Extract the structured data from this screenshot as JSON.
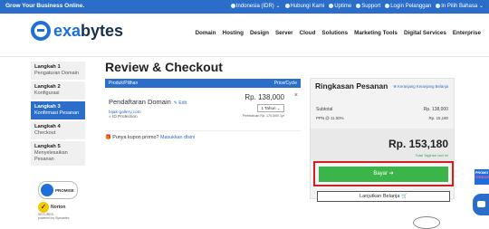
{
  "topbar": {
    "tagline": "Grow Your Business Online.",
    "links": [
      {
        "icon": "flag-icon",
        "label": "Indonesia (IDR) ⌄"
      },
      {
        "icon": "phone-icon",
        "label": "Hubungi Kami"
      },
      {
        "icon": "cloud-icon",
        "label": "Uptime"
      },
      {
        "icon": "support-icon",
        "label": "Support"
      },
      {
        "icon": "user-icon",
        "label": "Login Pelanggan"
      },
      {
        "icon": "translate-icon",
        "label": "In Pilih Bahasa ⌄"
      }
    ]
  },
  "brand": {
    "name_prefix": "exa",
    "name_suffix": "bytes"
  },
  "menu": [
    "Domain",
    "Hosting",
    "Design",
    "Server",
    "Cloud",
    "Solutions",
    "Marketing Tools",
    "Digital Services",
    "Enterprise"
  ],
  "steps": [
    {
      "step": "Langkah 1",
      "label": "Pengaturan Domain",
      "active": false
    },
    {
      "step": "Langkah 2",
      "label": "Konfigurasi",
      "active": false
    },
    {
      "step": "Langkah 3",
      "label": "Konfirmasi Pesanan",
      "active": true
    },
    {
      "step": "Langkah 4",
      "label": "Checkout",
      "active": false
    },
    {
      "step": "Langkah 5",
      "label": "Menyelesaikan Pesanan",
      "active": false
    }
  ],
  "badges": {
    "promise": "PROMISE",
    "norton": "Norton",
    "norton_sub": "SECURED",
    "norton_by": "powered by Symantec"
  },
  "page": {
    "title": "Review & Checkout"
  },
  "products": {
    "header_left": "Produk/Pilihan",
    "header_right": "Price/Cycle",
    "item": {
      "name": "Pendaftaran Domain",
      "edit": "✎ Edit",
      "domain": "bijak-gallery.com",
      "addon": "» ID Protection",
      "price": "Rp. 138,000",
      "cycle": "1 Tahun ⌄",
      "renewal": "Pembaruan Rp. 170,000/ 1yr",
      "remove": "×"
    }
  },
  "promo": {
    "text": "Punya kupon promo?",
    "link": "Masukkan disini"
  },
  "summary": {
    "title": "Ringkasan Pesanan",
    "currency_link": "⊕ Keranjang Keranjang Belanja",
    "subtotal_label": "Subtotal",
    "subtotal_value": "Rp. 138,000",
    "tax_label": "PPN @ 11.00%",
    "tax_value": "Rp. 15,180",
    "total": "Rp. 153,180",
    "due_label": "Total Tagihan hari ini"
  },
  "actions": {
    "pay": "Bayar ➔",
    "continue": "Lanjutkan Belanja 🛒"
  },
  "promo_tab": {
    "line1": "PROMO",
    "line2": "TERBARU"
  }
}
